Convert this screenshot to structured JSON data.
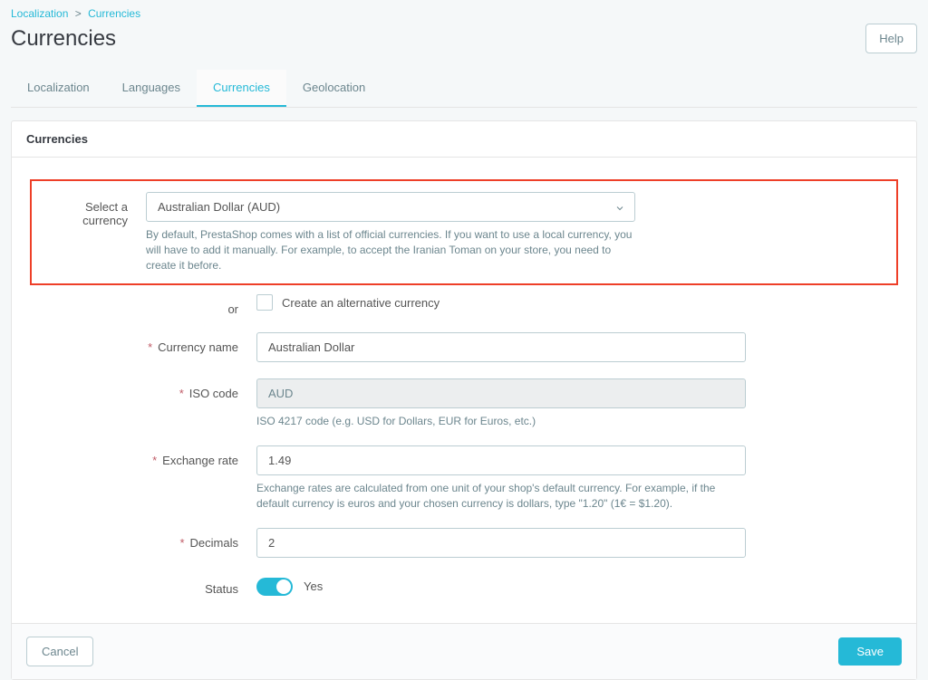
{
  "breadcrumb": {
    "parent": "Localization",
    "current": "Currencies"
  },
  "header": {
    "title": "Currencies",
    "help_label": "Help"
  },
  "tabs": [
    {
      "label": "Localization",
      "active": false
    },
    {
      "label": "Languages",
      "active": false
    },
    {
      "label": "Currencies",
      "active": true
    },
    {
      "label": "Geolocation",
      "active": false
    }
  ],
  "card": {
    "title": "Currencies"
  },
  "form": {
    "select_currency": {
      "label": "Select a currency",
      "value": "Australian Dollar (AUD)",
      "hint": "By default, PrestaShop comes with a list of official currencies. If you want to use a local currency, you will have to add it manually. For example, to accept the Iranian Toman on your store, you need to create it before."
    },
    "or_label": "or",
    "alt_currency": {
      "label": "Create an alternative currency",
      "checked": false
    },
    "currency_name": {
      "label": "Currency name",
      "value": "Australian Dollar"
    },
    "iso_code": {
      "label": "ISO code",
      "value": "AUD",
      "hint": "ISO 4217 code (e.g. USD for Dollars, EUR for Euros, etc.)"
    },
    "exchange_rate": {
      "label": "Exchange rate",
      "value": "1.49",
      "hint": "Exchange rates are calculated from one unit of your shop's default currency. For example, if the default currency is euros and your chosen currency is dollars, type \"1.20\" (1€ = $1.20)."
    },
    "decimals": {
      "label": "Decimals",
      "value": "2"
    },
    "status": {
      "label": "Status",
      "value": "Yes",
      "enabled": true
    }
  },
  "footer": {
    "cancel": "Cancel",
    "save": "Save"
  }
}
